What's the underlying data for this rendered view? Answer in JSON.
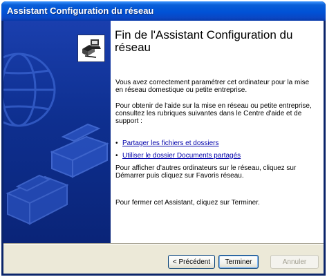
{
  "window": {
    "title": "Assistant Configuration du réseau"
  },
  "content": {
    "heading": "Fin de l'Assistant Configuration du réseau",
    "para1": "Vous avez correctement paramétrer cet ordinateur pour la mise en réseau domestique ou petite entreprise.",
    "para2": "Pour obtenir de l'aide sur la mise en réseau ou petite entreprise, consultez les rubriques suivantes dans le Centre d'aide et de support :",
    "links": [
      {
        "bullet": "•",
        "label": "Partager les fichiers et dossiers"
      },
      {
        "bullet": "•",
        "label": "Utiliser le dossier Documents partagés"
      }
    ],
    "para3": "Pour afficher d'autres ordinateurs sur le réseau, cliquez sur Démarrer puis cliquez sur Favoris réseau.",
    "para4": "Pour fermer cet Assistant, cliquez sur Terminer."
  },
  "buttons": {
    "back": "< Précédent",
    "finish": "Terminer",
    "cancel": "Annuler"
  },
  "colors": {
    "title_bar": "#0052d6",
    "left_panel": "#0e2f8f",
    "link": "#0000aa",
    "dialog_face": "#ece9d8"
  },
  "icons": {
    "wizard": "network-computers-icon",
    "globe": "globe-watermark-icon",
    "printer": "printer-watermark-icon",
    "fax": "fax-watermark-icon"
  }
}
